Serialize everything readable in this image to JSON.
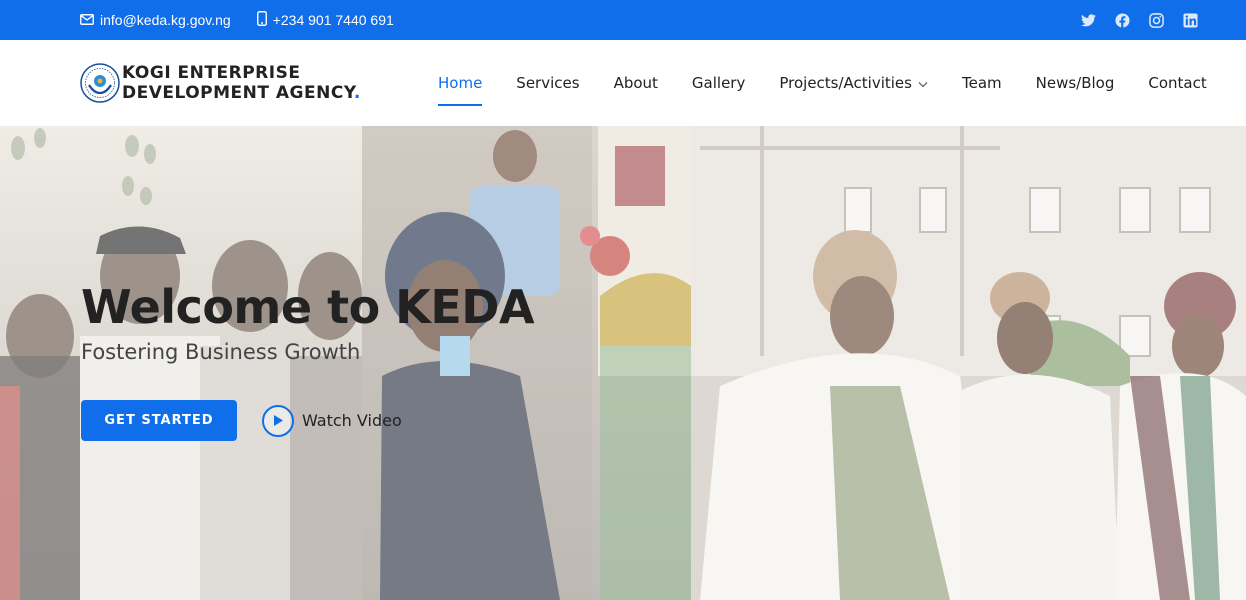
{
  "topbar": {
    "email": "info@keda.kg.gov.ng",
    "phone": "+234 901 7440 691",
    "bg_color": "#106eea",
    "social": [
      "twitter-icon",
      "facebook-icon",
      "instagram-icon",
      "linkedin-icon"
    ]
  },
  "header": {
    "logo_line1": "KOGI ENTERPRISE",
    "logo_line2": "DEVELOPMENT AGENCY",
    "logo_dot": ".",
    "nav": [
      {
        "label": "Home",
        "active": true
      },
      {
        "label": "Services"
      },
      {
        "label": "About"
      },
      {
        "label": "Gallery"
      },
      {
        "label": "Projects/Activities",
        "dropdown": true
      },
      {
        "label": "Team"
      },
      {
        "label": "News/Blog"
      },
      {
        "label": "Contact"
      }
    ],
    "accent_color": "#106eea"
  },
  "hero": {
    "title": "Welcome to KEDA",
    "subtitle": "Fostering Business Growth",
    "cta_label": "GET STARTED",
    "video_label": "Watch Video"
  }
}
